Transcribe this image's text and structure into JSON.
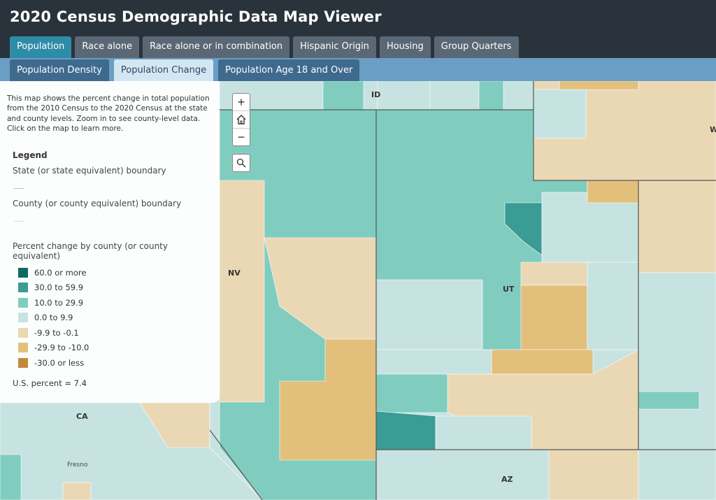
{
  "app": {
    "title": "2020 Census Demographic Data Map Viewer"
  },
  "tabs_primary": [
    {
      "label": "Population",
      "active": true
    },
    {
      "label": "Race alone",
      "active": false
    },
    {
      "label": "Race alone or in combination",
      "active": false
    },
    {
      "label": "Hispanic Origin",
      "active": false
    },
    {
      "label": "Housing",
      "active": false
    },
    {
      "label": "Group Quarters",
      "active": false
    }
  ],
  "tabs_secondary": [
    {
      "label": "Population Density",
      "active": false
    },
    {
      "label": "Population Change",
      "active": true
    },
    {
      "label": "Population Age 18 and Over",
      "active": false
    }
  ],
  "panel": {
    "description": "This map shows the percent change in total population from the 2010 Census to the 2020 Census at the state and county levels. Zoom in to see county-level data. Click on the map to learn more.",
    "legend_title": "Legend",
    "state_boundary": "State (or state equivalent) boundary",
    "county_boundary": "County (or county equivalent) boundary",
    "classes_heading": "Percent change by county (or county equivalent)",
    "classes": [
      {
        "label": "60.0 or more",
        "color": "#0f6b61"
      },
      {
        "label": "30.0 to 59.9",
        "color": "#3a9c95"
      },
      {
        "label": "10.0 to 29.9",
        "color": "#80cdc0"
      },
      {
        "label": "0.0 to 9.9",
        "color": "#c7e3e1"
      },
      {
        "label": "-9.9 to -0.1",
        "color": "#ead8b5"
      },
      {
        "label": "-29.9 to -10.0",
        "color": "#e2c07c"
      },
      {
        "label": "-30.0 or less",
        "color": "#c28a3c"
      }
    ],
    "us_percent": "U.S. percent = 7.4"
  },
  "map_controls": {
    "zoom_in": "+",
    "zoom_out": "−"
  },
  "map_labels": {
    "states": [
      "ID",
      "NV",
      "UT",
      "CA",
      "AZ",
      "W"
    ],
    "cities": [
      "Fresno"
    ]
  }
}
